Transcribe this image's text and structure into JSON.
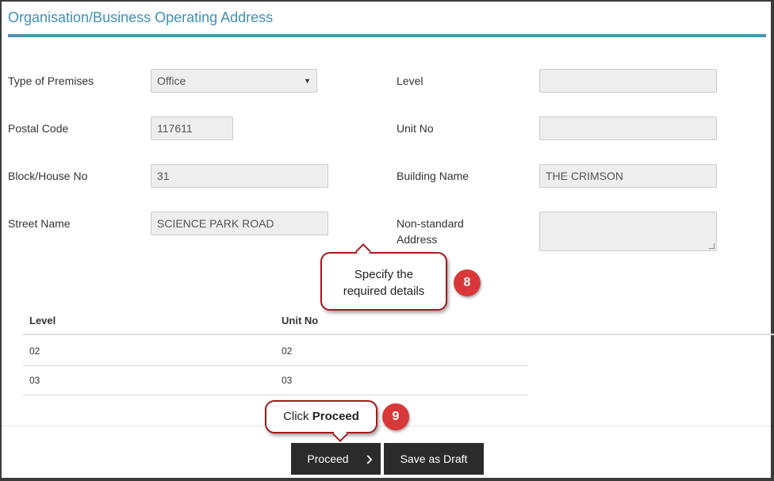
{
  "section": {
    "title": "Organisation/Business Operating Address"
  },
  "form": {
    "type_of_premises_label": "Type of Premises",
    "type_of_premises_value": "Office",
    "postal_code_label": "Postal Code",
    "postal_code_value": "117611",
    "block_house_label": "Block/House No",
    "block_house_value": "31",
    "street_name_label": "Street Name",
    "street_name_value": "SCIENCE PARK ROAD",
    "level_label": "Level",
    "level_value": "",
    "unit_no_label": "Unit No",
    "unit_no_value": "",
    "building_name_label": "Building Name",
    "building_name_value": "THE CRIMSON",
    "non_standard_label_line1": "Non-standard",
    "non_standard_label_line2": "Address",
    "non_standard_value": ""
  },
  "table": {
    "headers": [
      "Level",
      "Unit No"
    ],
    "rows": [
      [
        "02",
        "02"
      ],
      [
        "03",
        "03"
      ]
    ]
  },
  "callouts": {
    "specify_line1": "Specify the",
    "specify_line2": "required details",
    "specify_badge": "8",
    "click_prefix": "Click ",
    "click_bold": "Proceed",
    "click_badge": "9"
  },
  "actions": {
    "proceed_label": "Proceed",
    "draft_label": "Save as Draft"
  },
  "icons": {
    "select_arrow": "caret-down-icon",
    "proceed_chevron": "chevron-right-icon"
  },
  "colors": {
    "title": "#3f8fb7",
    "rule": "#4e93b3",
    "button": "#2b2b2b",
    "callout_border": "#a5191d",
    "badge": "#d9383a"
  }
}
